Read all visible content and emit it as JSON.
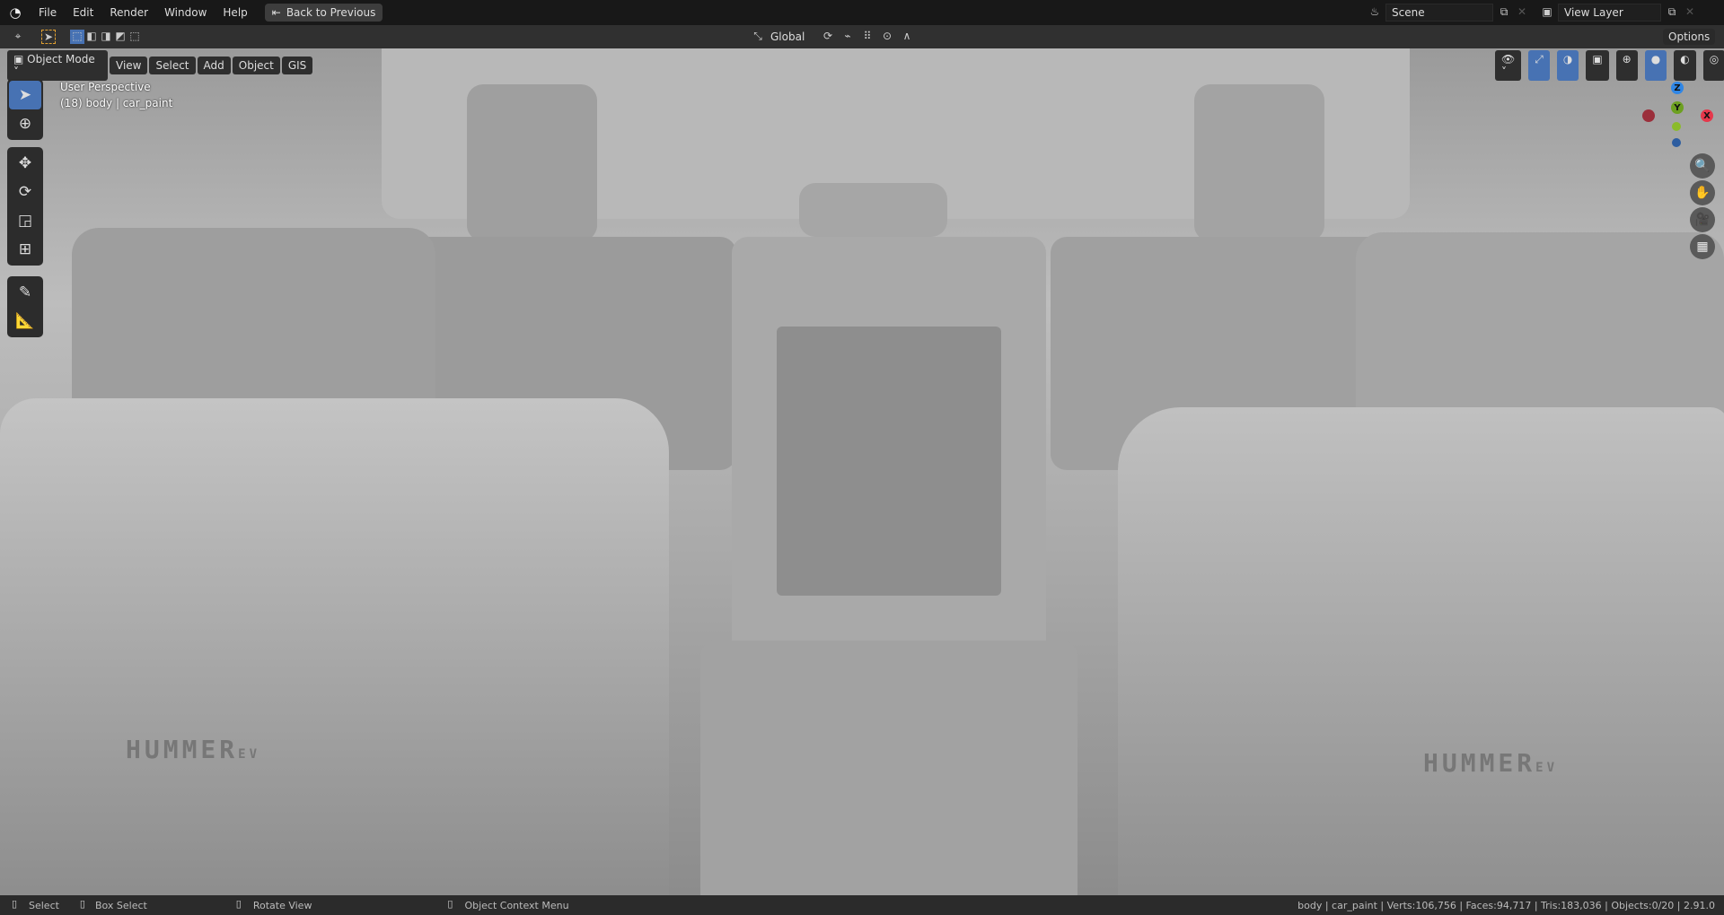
{
  "menu": {
    "items": [
      "File",
      "Edit",
      "Render",
      "Window",
      "Help"
    ],
    "back_button": "Back to Previous"
  },
  "scene": {
    "label": "Scene",
    "view_layer": "View Layer"
  },
  "tool_header": {
    "orientation": "Global",
    "options": "Options"
  },
  "viewport_header": {
    "mode": "Object Mode",
    "menus": [
      "View",
      "Select",
      "Add",
      "Object",
      "GIS"
    ]
  },
  "overlay": {
    "perspective": "User Perspective",
    "object_info": "(18) body | car_paint"
  },
  "gizmo": {
    "z": "Z",
    "y": "Y",
    "x": "X",
    "colors": {
      "x": "#e5384b",
      "y": "#6da021",
      "z": "#2f86e6"
    }
  },
  "model_text": {
    "brand": "HUMMER",
    "suffix": "EV"
  },
  "status": {
    "select": "Select",
    "box_select": "Box Select",
    "rotate": "Rotate View",
    "context": "Object Context Menu",
    "stats": "body | car_paint | Verts:106,756 | Faces:94,717 | Tris:183,036 | Objects:0/20 | 2.91.0"
  },
  "accent": "#4772b3"
}
